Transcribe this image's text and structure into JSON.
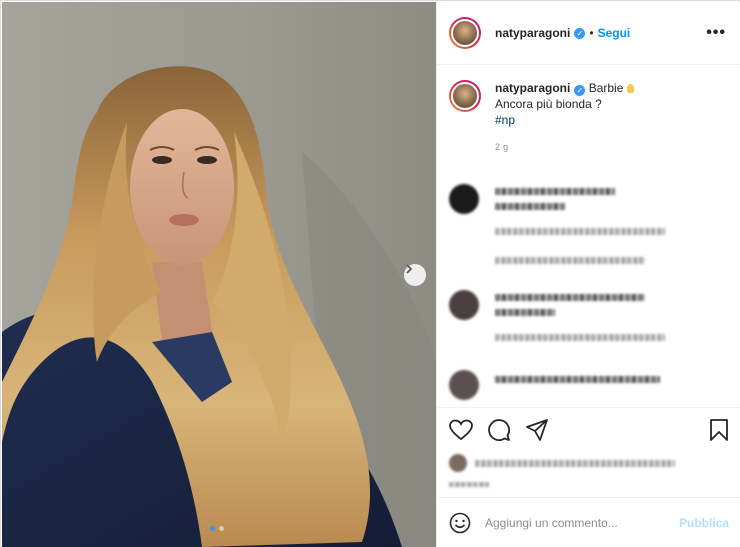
{
  "post": {
    "username": "natyparagoni",
    "follow_label": "Segui",
    "bullet": "•",
    "more_label": "•••",
    "caption_title": "Barbie",
    "caption_line2": "Ancora più bionda ?",
    "hashtag": "#np",
    "timestamp": "2 g"
  },
  "composer": {
    "placeholder": "Aggiungi un commento...",
    "publish_label": "Pubblica"
  },
  "colors": {
    "accent": "#0095f6",
    "verified": "#3897f0",
    "muted": "#8e8e8e"
  },
  "icons": [
    "heart-icon",
    "comment-icon",
    "share-icon",
    "bookmark-icon",
    "emoji-icon",
    "chevron-right-icon",
    "more-icon",
    "verified-icon"
  ]
}
